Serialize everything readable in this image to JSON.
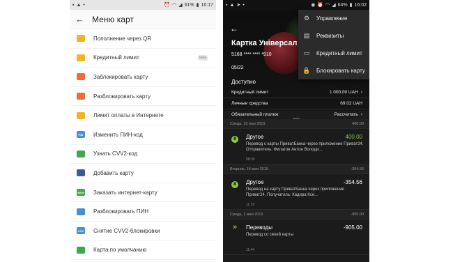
{
  "left_phone": {
    "status_bar": {
      "time": "16:17",
      "battery": "61%"
    },
    "header": {
      "title": "Меню карт"
    },
    "menu_items": [
      {
        "label": "Пополнение через QR",
        "icon": "qr-icon",
        "color": "#f5b224",
        "badge": ""
      },
      {
        "label": "Кредитный лимит",
        "icon": "credit-limit-icon",
        "color": "#f5b224",
        "badge": "beta"
      },
      {
        "label": "Заблокировать карту",
        "icon": "lock-card-icon",
        "color": "#ef6c3a",
        "badge": ""
      },
      {
        "label": "Разблокировать карту",
        "icon": "unlock-card-icon",
        "color": "#ef6c3a",
        "badge": ""
      },
      {
        "label": "Лимит оплаты в Интернете",
        "icon": "internet-limit-icon",
        "color": "#f5b224",
        "badge": ""
      },
      {
        "label": "Изменить ПИН-код",
        "icon": "pin-icon",
        "color": "#4a8fd6",
        "badge": "",
        "icon_text": "PIN"
      },
      {
        "label": "Узнать CVV2-код",
        "icon": "eye-icon",
        "color": "#3ea84a",
        "badge": ""
      },
      {
        "label": "Добавить карту",
        "icon": "add-card-icon",
        "color": "#3b5a99",
        "badge": ""
      },
      {
        "label": "Заказать интернет-карту",
        "icon": "new-card-icon",
        "color": "#3ea84a",
        "badge": "",
        "icon_text": "NEW"
      },
      {
        "label": "Разблокировать ПИН",
        "icon": "unlock-pin-icon",
        "color": "#4a8fd6",
        "badge": ""
      },
      {
        "label": "Снятие CVV2-блокировки",
        "icon": "cvv-unlock-icon",
        "color": "#4a8fd6",
        "badge": "",
        "icon_text": "CVV"
      },
      {
        "label": "Карта по умолчанию",
        "icon": "default-card-icon",
        "color": "#3ea84a",
        "badge": ""
      }
    ]
  },
  "right_phone": {
    "status_bar": {
      "time": "16:02",
      "battery": "64%"
    },
    "card": {
      "title": "Картка Універсал",
      "number": "5168 **** **** *910",
      "expiry": "05/22",
      "available_label": "Доступно"
    },
    "info_rows": [
      {
        "label": "Кредитный лимит",
        "value": "1 000.00 UAH"
      },
      {
        "label": "Личные средства",
        "value": "69.02 UAH"
      },
      {
        "label": "Обязательный платеж",
        "value": "Рассчитать"
      }
    ],
    "dropdown": [
      {
        "label": "Управление",
        "icon": "gear-icon"
      },
      {
        "label": "Реквизиты",
        "icon": "document-icon"
      },
      {
        "label": "Кредитный лимит",
        "icon": "credit-limit-icon"
      },
      {
        "label": "Блокировать карту",
        "icon": "lock-icon"
      }
    ],
    "history": [
      {
        "date": "Среда, 15 мая 2019",
        "day_total": "400.00",
        "tx": {
          "name": "Другое",
          "amount": "400.00",
          "amount_color": "green",
          "description": "Перевод с карты ПриватБанка через приложение Приват24. Отправитель: Филатов Антон Володи...",
          "time": "08:39"
        }
      },
      {
        "date": "Вторник, 14 мая 2019",
        "day_total": "-354.56",
        "tx": {
          "name": "Другое",
          "amount": "-354.56",
          "amount_color": "white",
          "description": "Перевод на карту ПриватБанка через приложение Приват24. Получатель: Кадира Ксе...",
          "time": "11:19"
        }
      },
      {
        "date": "Среда, 1 мая 2019",
        "day_total": "-905.00",
        "tx": {
          "name": "Переводы",
          "amount": "-905.00",
          "amount_color": "white",
          "description": "Перевод со своей карты",
          "time": "11:44"
        }
      }
    ]
  }
}
